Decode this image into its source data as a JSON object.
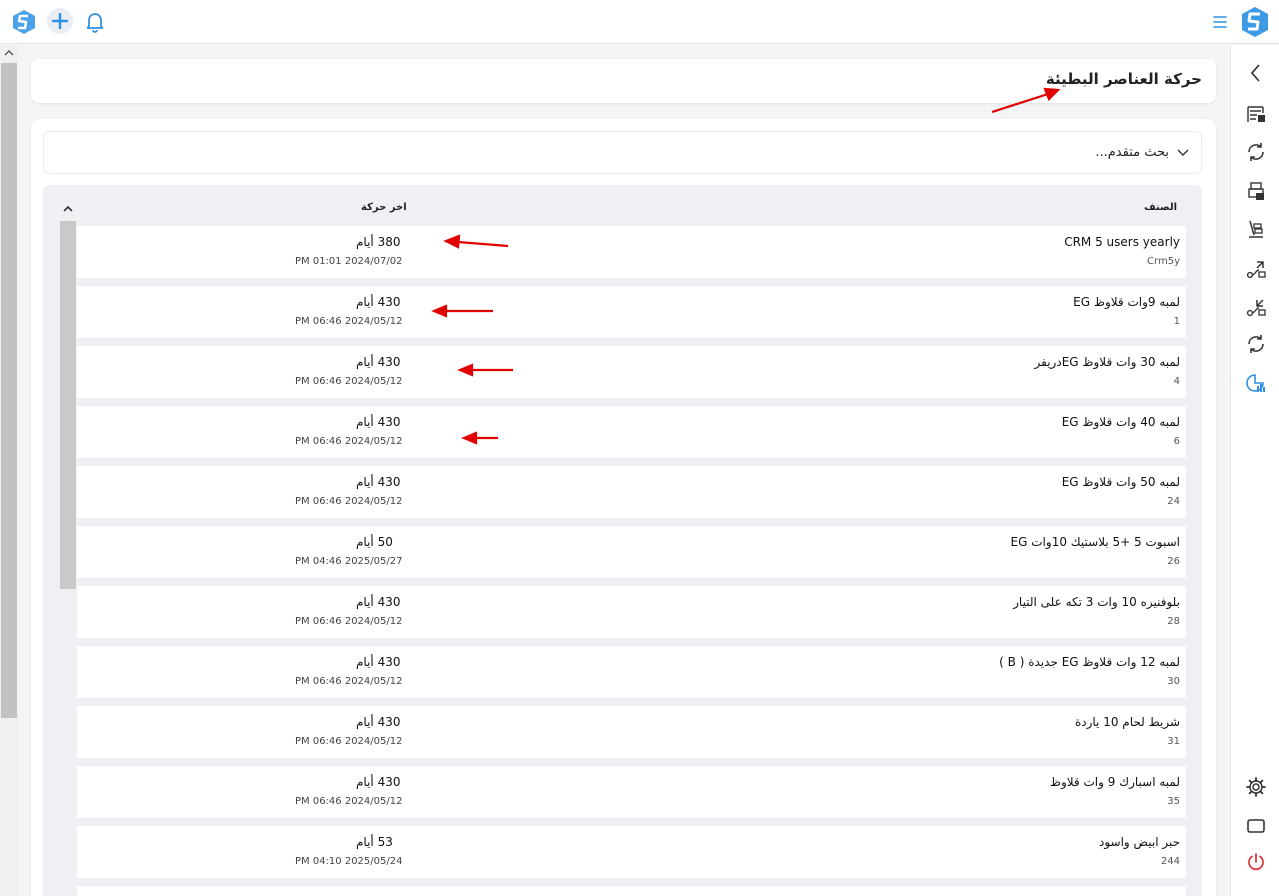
{
  "page": {
    "title": "حركة العناصر البطيئة",
    "advanced_search_label": "بحث متقدم..."
  },
  "table": {
    "columns": {
      "item": "الصنف",
      "last_movement": "اخر حركة"
    },
    "rows": [
      {
        "name": "CRM 5 users yearly",
        "code": "Crm5y",
        "days": "380 أيام",
        "date": "PM 01:01 2024/07/02"
      },
      {
        "name": "لمبه 9وات قلاوظ EG",
        "code": "1",
        "days": "430 أيام",
        "date": "PM 06:46 2024/05/12"
      },
      {
        "name": "لمبه 30 وات قلاوظ EGدريفر",
        "code": "4",
        "days": "430 أيام",
        "date": "PM 06:46 2024/05/12"
      },
      {
        "name": "لمبه 40 وات قلاوظ EG",
        "code": "6",
        "days": "430 أيام",
        "date": "PM 06:46 2024/05/12"
      },
      {
        "name": "لمبه 50 وات قلاوظ EG",
        "code": "24",
        "days": "430 أيام",
        "date": "PM 06:46 2024/05/12"
      },
      {
        "name": "اسبوت 5 +5 بلاستيك 10وات EG",
        "code": "26",
        "days": "50 أيام",
        "date": "PM 04:46 2025/05/27"
      },
      {
        "name": "بلوفنيره 10 وات 3 تكه على التيار",
        "code": "28",
        "days": "430 أيام",
        "date": "PM 06:46 2024/05/12"
      },
      {
        "name": "لمبه 12 وات قلاوظ EG جديدة ( B )",
        "code": "30",
        "days": "430 أيام",
        "date": "PM 06:46 2024/05/12"
      },
      {
        "name": "شريط لحام 10 ياردة",
        "code": "31",
        "days": "430 أيام",
        "date": "PM 06:46 2024/05/12"
      },
      {
        "name": "لمبه اسبارك  9 وات قلاوظ",
        "code": "35",
        "days": "430 أيام",
        "date": "PM 06:46 2024/05/12"
      },
      {
        "name": "حبر ابيض واسود",
        "code": "244",
        "days": "53 أيام",
        "date": "PM 04:10 2025/05/24"
      }
    ]
  },
  "icons": {
    "top_left": [
      "app-logo-icon",
      "plus-icon",
      "bell-icon"
    ],
    "top_right": [
      "menu-icon",
      "app-logo-icon"
    ],
    "sidebar": [
      "chevron-left-icon",
      "warehouse-icon",
      "sync-icon",
      "printer-icon",
      "hand-truck-icon",
      "transfer-icon",
      "transfer-icon",
      "sync-icon",
      "chart-icon",
      "gear-icon",
      "tablet-icon",
      "power-icon"
    ]
  },
  "colors": {
    "accent": "#2f8fe0",
    "power": "#e0303a",
    "annotation_arrow": "#e00000"
  }
}
